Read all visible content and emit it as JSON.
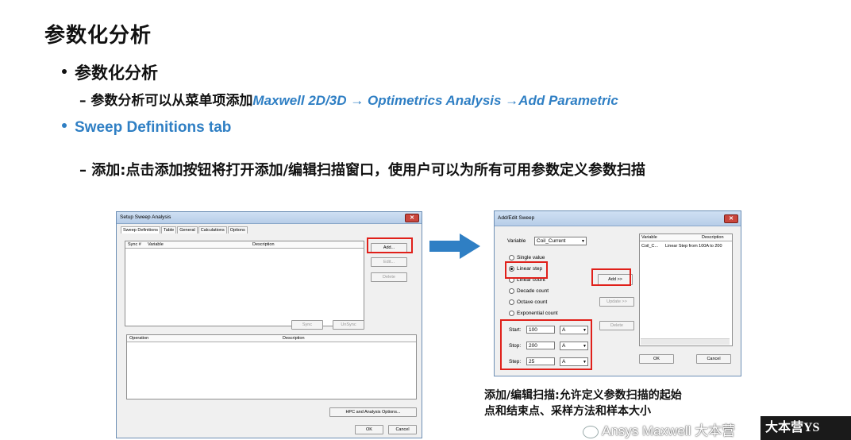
{
  "slide": {
    "title": "参数化分析",
    "bullet1": "参数化分析",
    "sub1_prefix": "– 参数分析可以从菜单项添加",
    "sub1_path": "Maxwell 2D/3D → Optimetrics Analysis →Add Parametric",
    "bullet2": "Sweep Definitions  tab",
    "sub2": "– 添加:点击添加按钮将打开添加/编辑扫描窗口，使用户可以为所有可用参数定义参数扫描",
    "caption_line1": "添加/编辑扫描:允许定义参数扫描的起始",
    "caption_line2": "点和结束点、采样方法和样本大小",
    "watermark": "Ansys Maxwell 大本营",
    "logo_text": "大本营YS",
    "accent_color": "#2f7fc4",
    "highlight_color": "#e0201a"
  },
  "setup_dialog": {
    "title": "Setup Sweep Analysis",
    "tabs": [
      "Sweep Definitions",
      "Table",
      "General",
      "Calculations",
      "Options"
    ],
    "columns": [
      "Sync #",
      "Variable",
      "Description"
    ],
    "add": "Add...",
    "edit": "Edit...",
    "delete": "Delete",
    "sync": "Sync",
    "unsync": "UnSync",
    "op_columns": [
      "Operation",
      "Description"
    ],
    "hpc": "HPC and Analysis Options...",
    "ok": "OK",
    "cancel": "Cancel"
  },
  "edit_dialog": {
    "title": "Add/Edit Sweep",
    "variable_label": "Variable",
    "variable_value": "Coil_Current",
    "options": [
      "Single value",
      "Linear step",
      "Linear count",
      "Decade count",
      "Octave count",
      "Exponential count"
    ],
    "selected_option": "Linear step",
    "start_label": "Start:",
    "start_value": "100",
    "start_unit": "A",
    "stop_label": "Stop:",
    "stop_value": "200",
    "stop_unit": "A",
    "step_label": "Step:",
    "step_value": "25",
    "step_unit": "A",
    "add": "Add >>",
    "update": "Update >>",
    "delete": "Delete",
    "columns": [
      "Variable",
      "Description"
    ],
    "row_variable": "Coil_C...",
    "row_description": "Linear Step from 100A to 200",
    "ok": "OK",
    "cancel": "Cancel"
  }
}
